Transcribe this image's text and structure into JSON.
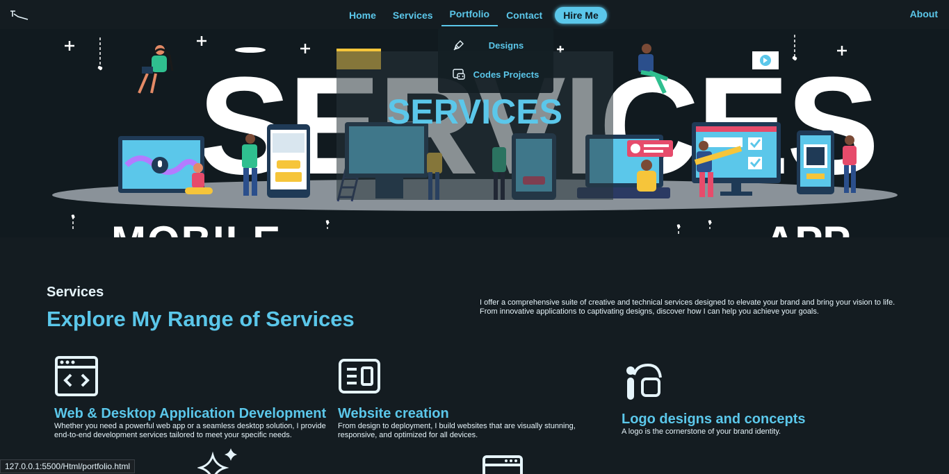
{
  "nav": {
    "links": [
      {
        "label": "Home"
      },
      {
        "label": "Services"
      },
      {
        "label": "Portfolio"
      },
      {
        "label": "Contact"
      }
    ],
    "hire_label": "Hire Me",
    "about_label": "About",
    "accent": "#5bc7ea"
  },
  "dropdown": {
    "items": [
      {
        "label": "Designs",
        "icon": "pen-icon"
      },
      {
        "label": "Codes Projects",
        "icon": "code-window-icon"
      }
    ]
  },
  "hero": {
    "big_word": "SERVICES",
    "word_left": "MOBILE",
    "word_right": "APP",
    "title": "SERVICES"
  },
  "services": {
    "label": "Services",
    "title": "Explore My Range of Services",
    "description": "I offer a comprehensive suite of creative and technical services designed to elevate your brand and bring your vision to life. From innovative applications to captivating designs, discover how I can help you achieve your goals.",
    "cards": [
      {
        "icon": "code-window-icon",
        "title": "Web & Desktop Application Development",
        "desc": "Whether you need a powerful web app or a seamless desktop solution, I provide end-to-end development services tailored to meet your specific needs."
      },
      {
        "icon": "layout-icon",
        "title": "Website creation",
        "desc": "From design to deployment, I build websites that are visually stunning, responsive, and optimized for all devices."
      },
      {
        "icon": "design-tools-icon",
        "title": "Logo designs and concepts",
        "desc": "A logo is the cornerstone of your brand identity."
      }
    ]
  },
  "status_url": "127.0.0.1:5500/Html/portfolio.html"
}
